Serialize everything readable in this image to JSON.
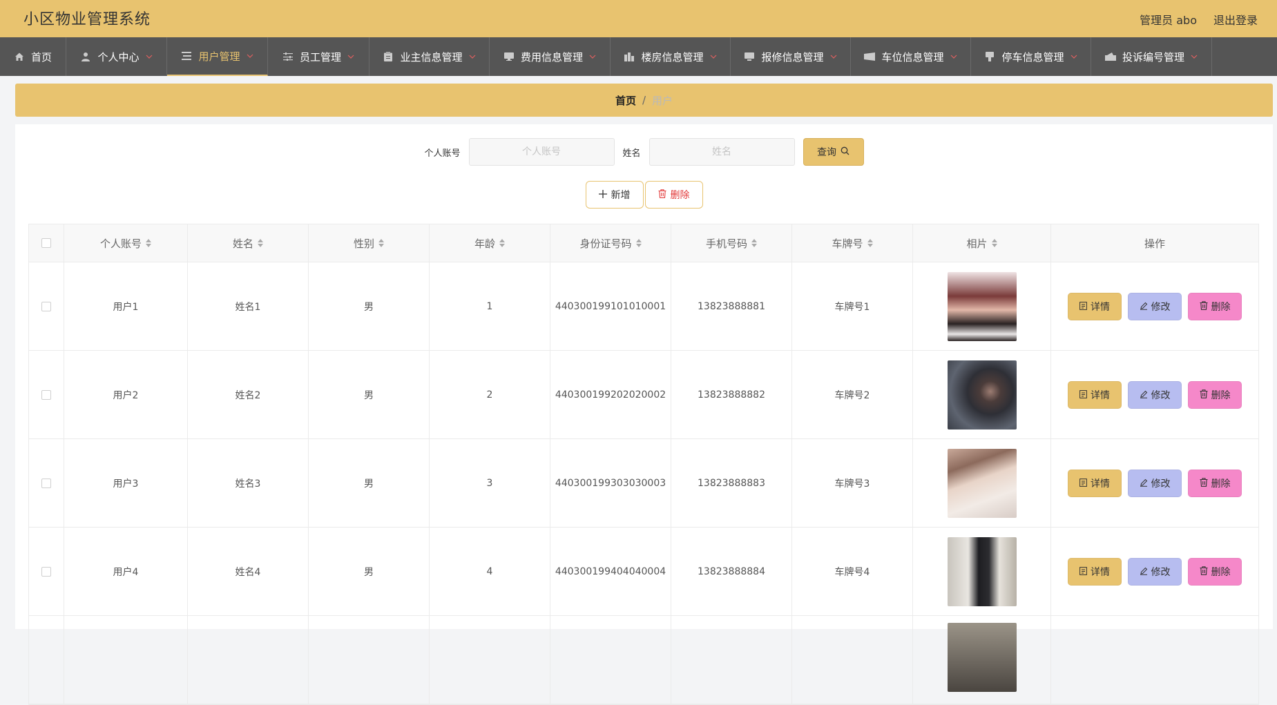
{
  "app": {
    "title": "小区物业管理系统"
  },
  "header": {
    "user": "管理员 abo",
    "logout": "退出登录"
  },
  "nav": [
    {
      "label": "首页",
      "icon": "home-icon",
      "has_caret": false
    },
    {
      "label": "个人中心",
      "icon": "user-icon",
      "has_caret": true
    },
    {
      "label": "用户管理",
      "icon": "list-icon",
      "has_caret": true,
      "active": true
    },
    {
      "label": "员工管理",
      "icon": "sliders-icon",
      "has_caret": true
    },
    {
      "label": "业主信息管理",
      "icon": "clipboard-icon",
      "has_caret": true
    },
    {
      "label": "费用信息管理",
      "icon": "monitor-icon",
      "has_caret": true
    },
    {
      "label": "楼房信息管理",
      "icon": "building-icon",
      "has_caret": true
    },
    {
      "label": "报修信息管理",
      "icon": "repair-icon",
      "has_caret": true
    },
    {
      "label": "车位信息管理",
      "icon": "ticket-icon",
      "has_caret": true
    },
    {
      "label": "停车信息管理",
      "icon": "parking-icon",
      "has_caret": true
    },
    {
      "label": "投诉编号管理",
      "icon": "complaint-icon",
      "has_caret": true
    }
  ],
  "breadcrumb": {
    "home": "首页",
    "separator": "/",
    "current": "用户"
  },
  "search": {
    "account_label": "个人账号",
    "account_placeholder": "个人账号",
    "name_label": "姓名",
    "name_placeholder": "姓名",
    "query_label": "查询"
  },
  "actions": {
    "add_label": "新增",
    "delete_label": "删除"
  },
  "table": {
    "columns": [
      "个人账号",
      "姓名",
      "性别",
      "年龄",
      "身份证号码",
      "手机号码",
      "车牌号",
      "相片",
      "操作"
    ],
    "op_labels": {
      "detail": "详情",
      "edit": "修改",
      "delete": "删除"
    },
    "rows": [
      {
        "account": "用户1",
        "name": "姓名1",
        "gender": "男",
        "age": "1",
        "id_card": "440300199101010001",
        "phone": "13823888881",
        "plate": "车牌号1"
      },
      {
        "account": "用户2",
        "name": "姓名2",
        "gender": "男",
        "age": "2",
        "id_card": "440300199202020002",
        "phone": "13823888882",
        "plate": "车牌号2"
      },
      {
        "account": "用户3",
        "name": "姓名3",
        "gender": "男",
        "age": "3",
        "id_card": "440300199303030003",
        "phone": "13823888883",
        "plate": "车牌号3"
      },
      {
        "account": "用户4",
        "name": "姓名4",
        "gender": "男",
        "age": "4",
        "id_card": "440300199404040004",
        "phone": "13823888884",
        "plate": "车牌号4"
      }
    ]
  },
  "colors": {
    "accent": "#e8c36f",
    "nav_bg": "#555555",
    "edit": "#b7bdf0",
    "delete": "#f588c9",
    "danger_text": "#e23a3a"
  }
}
